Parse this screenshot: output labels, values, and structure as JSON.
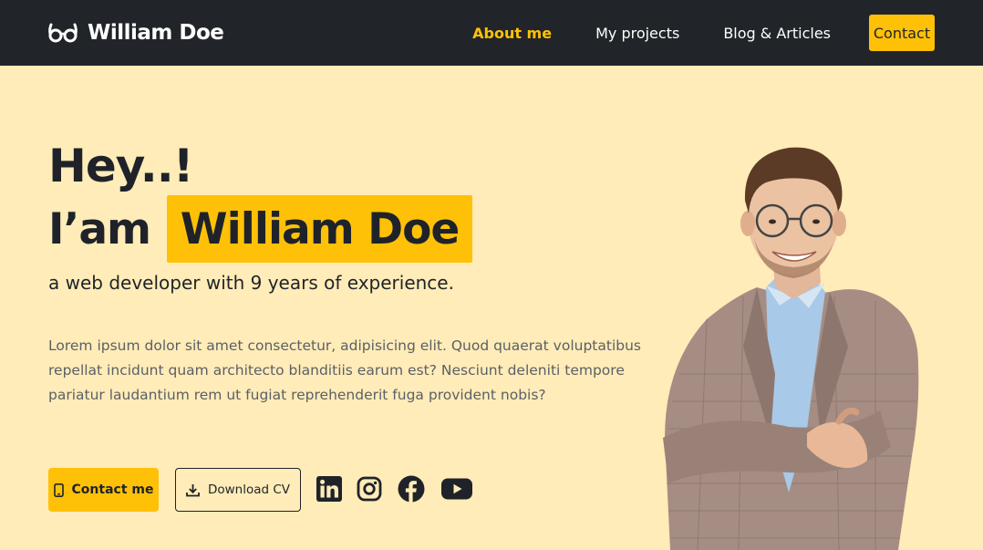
{
  "navbar": {
    "brand": {
      "name": "William Doe",
      "icon": "glasses-icon"
    },
    "links": [
      {
        "label": "About me",
        "active": true
      },
      {
        "label": "My projects",
        "active": false
      },
      {
        "label": "Blog & Articles",
        "active": false
      }
    ],
    "contact_label": "Contact"
  },
  "hero": {
    "greeting": "Hey..!",
    "intro": "I’am",
    "name": "William Doe",
    "subtitle": "a web developer with 9 years of experience.",
    "description": "Lorem ipsum dolor sit amet consectetur, adipisicing elit. Quod quaerat voluptatibus repellat incidunt quam architecto blanditiis earum est? Nesciunt deleniti tempore pariatur laudantium rem ut fugiat reprehenderit fuga provident nobis?"
  },
  "actions": {
    "contact_me": {
      "label": "Contact me",
      "icon": "phone-icon"
    },
    "download_cv": {
      "label": "Download CV",
      "icon": "download-icon"
    }
  },
  "social": [
    "linkedin-icon",
    "instagram-icon",
    "facebook-icon",
    "youtube-icon"
  ],
  "colors": {
    "accent": "#FFC107",
    "navbar_bg": "#212529",
    "page_bg": "#FFECB8",
    "text_dark": "#1F2329",
    "text_muted": "#5B5F66"
  }
}
